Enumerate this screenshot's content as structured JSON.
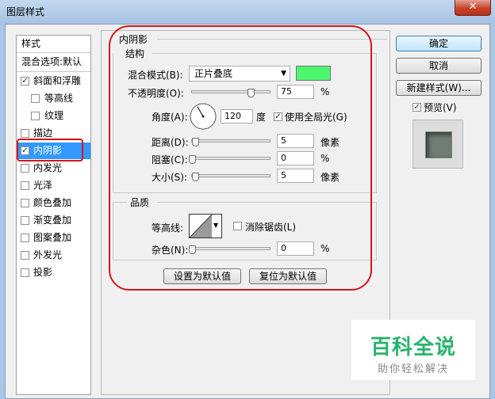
{
  "window": {
    "title": "图层样式",
    "close_glyph": "✕"
  },
  "left_panel": {
    "header": "样式",
    "blend_options": "混合选项:默认",
    "items": [
      {
        "label": "斜面和浮雕",
        "checked": true
      },
      {
        "label": "等高线",
        "checked": false
      },
      {
        "label": "纹理",
        "checked": false
      },
      {
        "label": "描边",
        "checked": false
      },
      {
        "label": "内阴影",
        "checked": true,
        "selected": true
      },
      {
        "label": "内发光",
        "checked": false
      },
      {
        "label": "光泽",
        "checked": false
      },
      {
        "label": "颜色叠加",
        "checked": false
      },
      {
        "label": "渐变叠加",
        "checked": false
      },
      {
        "label": "图案叠加",
        "checked": false
      },
      {
        "label": "外发光",
        "checked": false
      },
      {
        "label": "投影",
        "checked": false
      }
    ]
  },
  "inner_shadow": {
    "section_title": "内阴影",
    "structure_title": "结构",
    "blend_mode_label": "混合模式(B):",
    "blend_mode_value": "正片叠底",
    "color": "#4cf66f",
    "opacity_label": "不透明度(O):",
    "opacity_value": "75",
    "opacity_unit": "%",
    "opacity_level": 0.75,
    "angle_label": "角度(A):",
    "angle_value": "120",
    "angle_unit": "度",
    "global_light_label": "使用全局光(G)",
    "global_light_checked": true,
    "distance_label": "距离(D):",
    "distance_value": "5",
    "distance_unit": "像素",
    "choke_label": "阻塞(C):",
    "choke_value": "0",
    "choke_unit": "%",
    "size_label": "大小(S):",
    "size_value": "5",
    "size_unit": "像素",
    "quality_title": "品质",
    "contour_label": "等高线:",
    "antialias_label": "消除锯齿(L)",
    "antialias_checked": false,
    "noise_label": "杂色(N):",
    "noise_value": "0",
    "noise_unit": "%",
    "make_default_label": "设置为默认值",
    "reset_default_label": "复位为默认值"
  },
  "right_buttons": {
    "ok": "确定",
    "cancel": "取消",
    "new_style": "新建样式(W)...",
    "preview_label": "预览(V)",
    "preview_checked": true
  },
  "watermark": {
    "title": "百科全说",
    "subtitle": "助你轻松解决"
  },
  "colors": {
    "annotation": "#d4151b",
    "selection": "#3399ff"
  }
}
